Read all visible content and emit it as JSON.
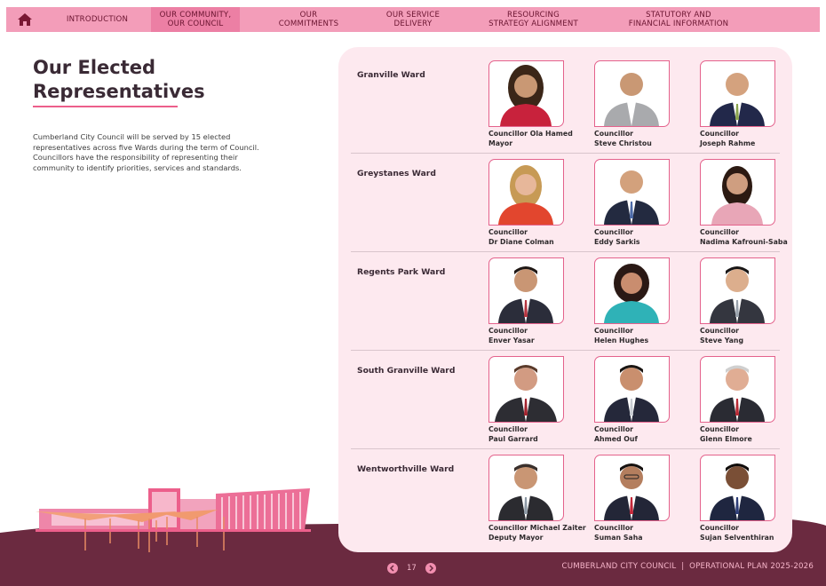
{
  "nav": {
    "items": [
      {
        "label": "INTRODUCTION",
        "active": false
      },
      {
        "label": "OUR COMMUNITY,\nOUR COUNCIL",
        "active": true
      },
      {
        "label": "OUR\nCOMMITMENTS",
        "active": false
      },
      {
        "label": "OUR SERVICE\nDELIVERY",
        "active": false
      },
      {
        "label": "RESOURCING\nSTRATEGY ALIGNMENT",
        "active": false
      },
      {
        "label": "STATUTORY AND\nFINANCIAL INFORMATION",
        "active": false
      }
    ]
  },
  "page": {
    "heading_line1": "Our Elected",
    "heading_line2": "Representatives",
    "intro": "Cumberland City Council will be served by 15 elected representatives across five Wards during the term of Council. Councillors have the responsibility of representing their community to identify priorities, services and standards."
  },
  "wards": [
    {
      "name": "Granville Ward",
      "members": [
        {
          "line1": "Councillor Ola Hamed",
          "line2": "Mayor"
        },
        {
          "line1": "Councillor",
          "line2": "Steve Christou"
        },
        {
          "line1": "Councillor",
          "line2": "Joseph Rahme"
        }
      ]
    },
    {
      "name": "Greystanes Ward",
      "members": [
        {
          "line1": "Councillor",
          "line2": "Dr Diane Colman"
        },
        {
          "line1": "Councillor",
          "line2": "Eddy Sarkis"
        },
        {
          "line1": "Councillor",
          "line2": "Nadima Kafrouni-Saba"
        }
      ]
    },
    {
      "name": "Regents Park Ward",
      "members": [
        {
          "line1": "Councillor",
          "line2": "Enver Yasar"
        },
        {
          "line1": "Councillor",
          "line2": "Helen Hughes"
        },
        {
          "line1": "Councillor",
          "line2": "Steve Yang"
        }
      ]
    },
    {
      "name": "South Granville Ward",
      "members": [
        {
          "line1": "Councillor",
          "line2": "Paul Garrard"
        },
        {
          "line1": "Councillor",
          "line2": "Ahmed Ouf"
        },
        {
          "line1": "Councillor",
          "line2": "Glenn Elmore"
        }
      ]
    },
    {
      "name": "Wentworthville Ward",
      "members": [
        {
          "line1": "Councillor Michael Zaiter",
          "line2": "Deputy Mayor"
        },
        {
          "line1": "Councillor",
          "line2": "Suman Saha"
        },
        {
          "line1": "Councillor",
          "line2": "Sujan Selventhiran"
        }
      ]
    }
  ],
  "footer": {
    "page_number": "17",
    "text": "CUMBERLAND CITY COUNCIL  |  OPERATIONAL PLAN 2025-2026"
  },
  "colors": {
    "nav_bg": "#f39db9",
    "nav_active": "#ec7fa4",
    "accent": "#ec5f8b",
    "panel_bg": "#fde9ef",
    "footer_bg": "#6b2a40"
  },
  "icons": [
    "home-icon",
    "arrow-left-icon",
    "arrow-right-icon",
    "building-illustration"
  ]
}
